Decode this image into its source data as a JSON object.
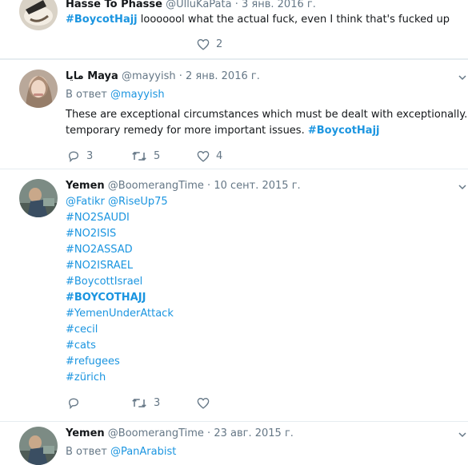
{
  "tweet1": {
    "name": "Hasse To Phasse",
    "handle": "@UlluKaPata",
    "dot": "·",
    "date": "3 янв. 2016 г.",
    "hashtag": "#BoycotHajj",
    "text": " looooool what the actual fuck, even I think that's fucked up",
    "likes": "2"
  },
  "tweet2": {
    "name": "مايا Maya",
    "handle": "@mayyish",
    "dot": "·",
    "date": "2 янв. 2016 г.",
    "reply_prefix": "В ответ",
    "reply_to": "@mayyish",
    "text_line1": "These are exceptional circumstances which must be dealt with exceptionally. A",
    "text_line2": "temporary remedy for more important issues. ",
    "hashtag": "#BoycotHajj",
    "replies": "3",
    "retweets": "5",
    "likes": "4"
  },
  "tweet3": {
    "name": "Yemen",
    "handle": "@BoomerangTime",
    "dot": "·",
    "date": "10 сент. 2015 г.",
    "mentions": "@Fatikr @RiseUp75",
    "hashtags": [
      "#NO2SAUDI",
      "#NO2ISIS",
      "#NO2ASSAD",
      "#NO2ISRAEL",
      "#BoycottIsrael",
      "#BOYCOTHAJJ",
      "#YemenUnderAttack",
      "#cecil",
      "#cats",
      "#refugees",
      "#zürich"
    ],
    "retweets": "3"
  },
  "tweet4": {
    "name": "Yemen",
    "handle": "@BoomerangTime",
    "dot": "·",
    "date": "23 авг. 2015 г.",
    "reply_prefix": "В ответ",
    "reply_to": "@PanArabist"
  },
  "colors": {
    "link": "#1b95e0",
    "muted": "#657786",
    "text": "#14171a",
    "divider": "#e6ecf0"
  }
}
